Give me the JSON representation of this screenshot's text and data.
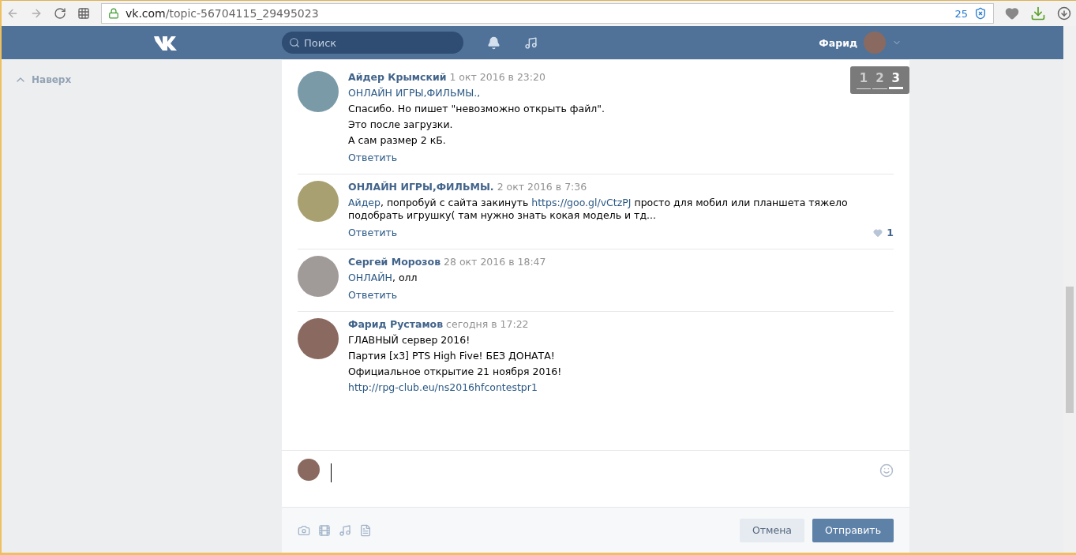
{
  "browser": {
    "url_host": "vk.com",
    "url_path": "/topic-56704115_29495023",
    "badge_count": "25"
  },
  "header": {
    "search_placeholder": "Поиск",
    "user_name": "Фарид"
  },
  "sidebar": {
    "back_to_top": "Наверх"
  },
  "pagination": [
    {
      "label": "1",
      "selected": false
    },
    {
      "label": "2",
      "selected": false
    },
    {
      "label": "3",
      "selected": true
    }
  ],
  "comments": [
    {
      "author": "Айдер Крымский",
      "date": "1 окт 2016 в 23:20",
      "paragraphs": [
        [
          {
            "kind": "link",
            "text": "ОНЛАЙН ИГРЫ,ФИЛЬМЫ.,"
          }
        ],
        [
          {
            "kind": "plain",
            "text": "Спасибо. Но пишет \"невозможно открыть файл\"."
          }
        ],
        [
          {
            "kind": "plain",
            "text": "Это после загрузки."
          }
        ],
        [
          {
            "kind": "plain",
            "text": "А сам размер 2 кБ."
          }
        ]
      ],
      "reply": "Ответить"
    },
    {
      "author": "ОНЛАЙН ИГРЫ,ФИЛЬМЫ.",
      "date": "2 окт 2016 в 7:36",
      "paragraphs": [
        [
          {
            "kind": "link",
            "text": "Айдер"
          },
          {
            "kind": "plain",
            "text": ", попробуй с сайта закинуть "
          },
          {
            "kind": "link",
            "text": "https://goo.gl/vCtzPJ"
          },
          {
            "kind": "plain",
            "text": " просто для мобил или планшета тяжело подобрать игрушку( там нужно знать кокая модель и тд..."
          }
        ]
      ],
      "reply": "Ответить",
      "likes": "1"
    },
    {
      "author": "Сергей Морозов",
      "date": "28 окт 2016 в 18:47",
      "paragraphs": [
        [
          {
            "kind": "link",
            "text": "ОНЛАЙН"
          },
          {
            "kind": "plain",
            "text": ", олл"
          }
        ]
      ],
      "reply": "Ответить"
    },
    {
      "author": "Фарид Рустамов",
      "date": "сегодня в 17:22",
      "paragraphs": [
        [
          {
            "kind": "plain",
            "text": "ГЛАВНЫЙ сервер 2016!"
          }
        ],
        [
          {
            "kind": "plain",
            "text": "Партия [x3] PTS High Five! БЕЗ ДОНАТА!"
          }
        ],
        [
          {
            "kind": "plain",
            "text": "Официальное открытие 21 ноября 2016!"
          }
        ],
        [
          {
            "kind": "link",
            "text": "http://rpg-club.eu/ns2016hfcontestpr1"
          }
        ]
      ]
    }
  ],
  "composer": {
    "cancel": "Отмена",
    "send": "Отправить"
  }
}
